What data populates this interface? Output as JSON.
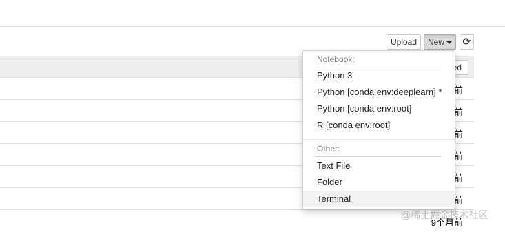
{
  "toolbar": {
    "upload_label": "Upload",
    "new_label": "New",
    "refresh_icon_glyph": "⟳"
  },
  "table": {
    "sort_label": "ed"
  },
  "rows": [
    {
      "modified": "前"
    },
    {
      "modified": "前"
    },
    {
      "modified": "前"
    },
    {
      "modified": "前"
    },
    {
      "modified": "前"
    },
    {
      "modified": "前"
    },
    {
      "modified": "9个月前"
    }
  ],
  "dropdown": {
    "notebook_header": "Notebook:",
    "notebook_items": [
      "Python 3",
      "Python [conda env:deeplearn] *",
      "Python [conda env:root]",
      "R [conda env:root]"
    ],
    "other_header": "Other:",
    "other_items": [
      "Text File",
      "Folder",
      "Terminal"
    ]
  },
  "watermark": "@稀土掘金技术社区"
}
